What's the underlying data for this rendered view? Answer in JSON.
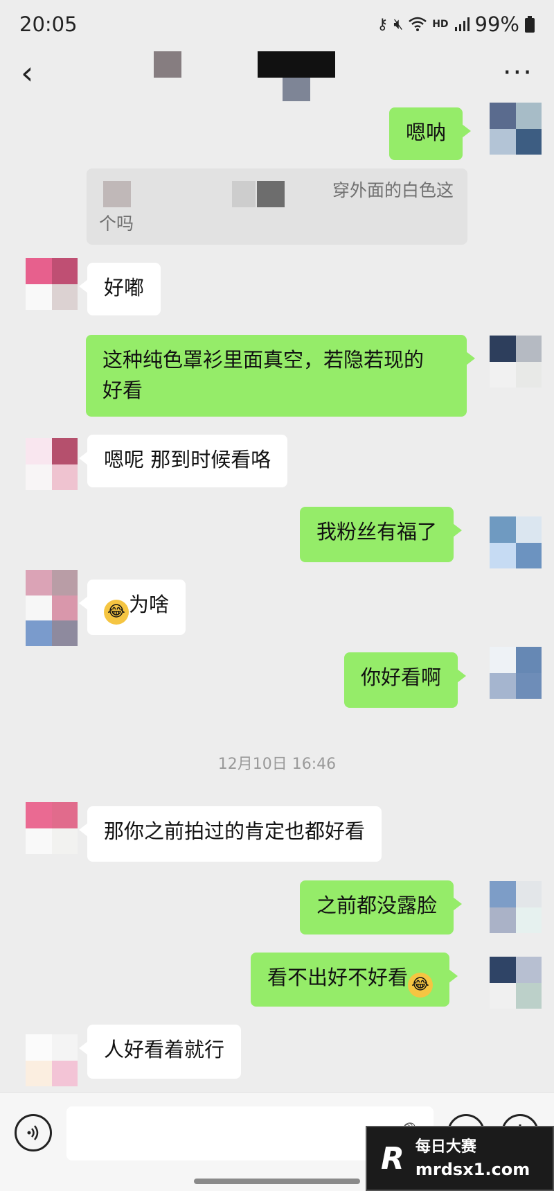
{
  "status_bar": {
    "time": "20:05",
    "icons": [
      "key-icon",
      "mute-icon",
      "wifi-icon",
      "hd-icon",
      "signal-icon"
    ],
    "hd_label": "HD",
    "battery": "99%"
  },
  "nav": {
    "back_icon": "chevron-left-icon",
    "more_icon": "more-icon",
    "more_label": "···",
    "back_label": "‹"
  },
  "messages": {
    "m1": "嗯呐",
    "quote_line1": "穿外面的白色这",
    "quote_line2": "个吗",
    "m2": "好嘟",
    "m3_line1": "这种纯色罩衫里面真空，若隐若现的",
    "m3_line2": "好看",
    "m4": "嗯呢 那到时候看咯",
    "m5": "我粉丝有福了",
    "m6": "为啥",
    "m7": "你好看啊",
    "timestamp": "12月10日 16:46",
    "m8": "那你之前拍过的肯定也都好看",
    "m9": "之前都没露脸",
    "m10": "看不出好不好看",
    "m11": "人好看着就行"
  },
  "input_bar": {
    "voice_icon": "voice-icon",
    "mic_icon": "mic-icon",
    "emoji_icon": "emoji-icon",
    "plus_icon": "plus-icon"
  },
  "watermark": {
    "logo": "R",
    "text": "每日大赛",
    "url": "mrdsx1.com"
  },
  "colors": {
    "background": "#ededed",
    "my_bubble": "#95ec69",
    "other_bubble": "#ffffff"
  }
}
